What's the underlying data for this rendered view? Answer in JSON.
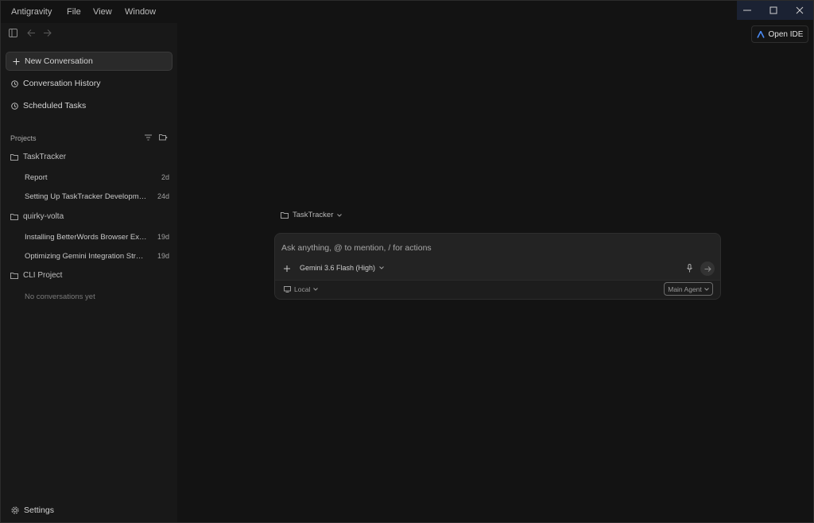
{
  "menu": [
    "Antigravity",
    "File",
    "View",
    "Window"
  ],
  "window_controls": {
    "minimize": "—",
    "maximize": "☐",
    "close": "✕"
  },
  "header": {
    "open_ide_label": "Open IDE"
  },
  "sidebar": {
    "new_conversation": "New Conversation",
    "history": "Conversation History",
    "scheduled": "Scheduled Tasks",
    "projects_label": "Projects",
    "projects": [
      {
        "name": "TaskTracker",
        "conversations": [
          {
            "title": "Report",
            "age": "2d"
          },
          {
            "title": "Setting Up TaskTracker Developm…",
            "age": "24d"
          }
        ]
      },
      {
        "name": "quirky-volta",
        "conversations": [
          {
            "title": "Installing BetterWords Browser Ex…",
            "age": "19d"
          },
          {
            "title": "Optimizing Gemini Integration Str…",
            "age": "19d"
          }
        ]
      },
      {
        "name": "CLI Project",
        "empty_text": "No conversations yet"
      }
    ],
    "settings": "Settings"
  },
  "composer": {
    "project_selector": "TaskTracker",
    "placeholder": "Ask anything, @ to mention, / for actions",
    "model": "Gemini 3.6 Flash (High)",
    "environment": "Local",
    "agent": "Main Agent"
  },
  "colors": {
    "accent_logo": "#4a8af4",
    "window_control_bg": "#1b2233"
  }
}
